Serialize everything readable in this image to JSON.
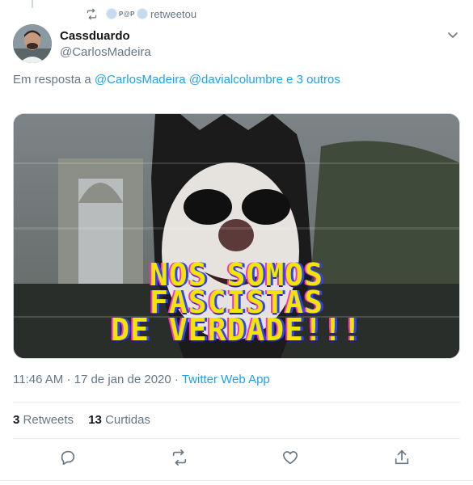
{
  "retweet": {
    "label": "retweetou",
    "icon": "retweet-icon",
    "mini_text": "P@P"
  },
  "tweet": {
    "author_name": "Cassduardo",
    "author_handle": "@CarlosMadeira",
    "reply_prefix": "Em resposta a",
    "reply_mentions": [
      "@CarlosMadeira",
      "@davialcolumbre"
    ],
    "reply_conjunction": "e",
    "reply_others": "3 outros",
    "media_caption": "NOS SOMOS\nFASCISTAS\nDE VERDADE!!!",
    "time": "11:46 AM",
    "date": "17 de jan de 2020",
    "separator": "·",
    "source": "Twitter Web App",
    "retweets_count": "3",
    "retweets_label": "Retweets",
    "likes_count": "13",
    "likes_label": "Curtidas"
  },
  "actions": [
    {
      "name": "reply",
      "icon": "reply-icon"
    },
    {
      "name": "retweet",
      "icon": "retweet-icon"
    },
    {
      "name": "like",
      "icon": "heart-icon"
    },
    {
      "name": "share",
      "icon": "share-icon"
    }
  ],
  "colors": {
    "link": "#1da1f2",
    "secondary_text": "#657786",
    "primary_text": "#14171a",
    "divider": "#e6ecf0",
    "caption_yellow": "#f2e600"
  }
}
